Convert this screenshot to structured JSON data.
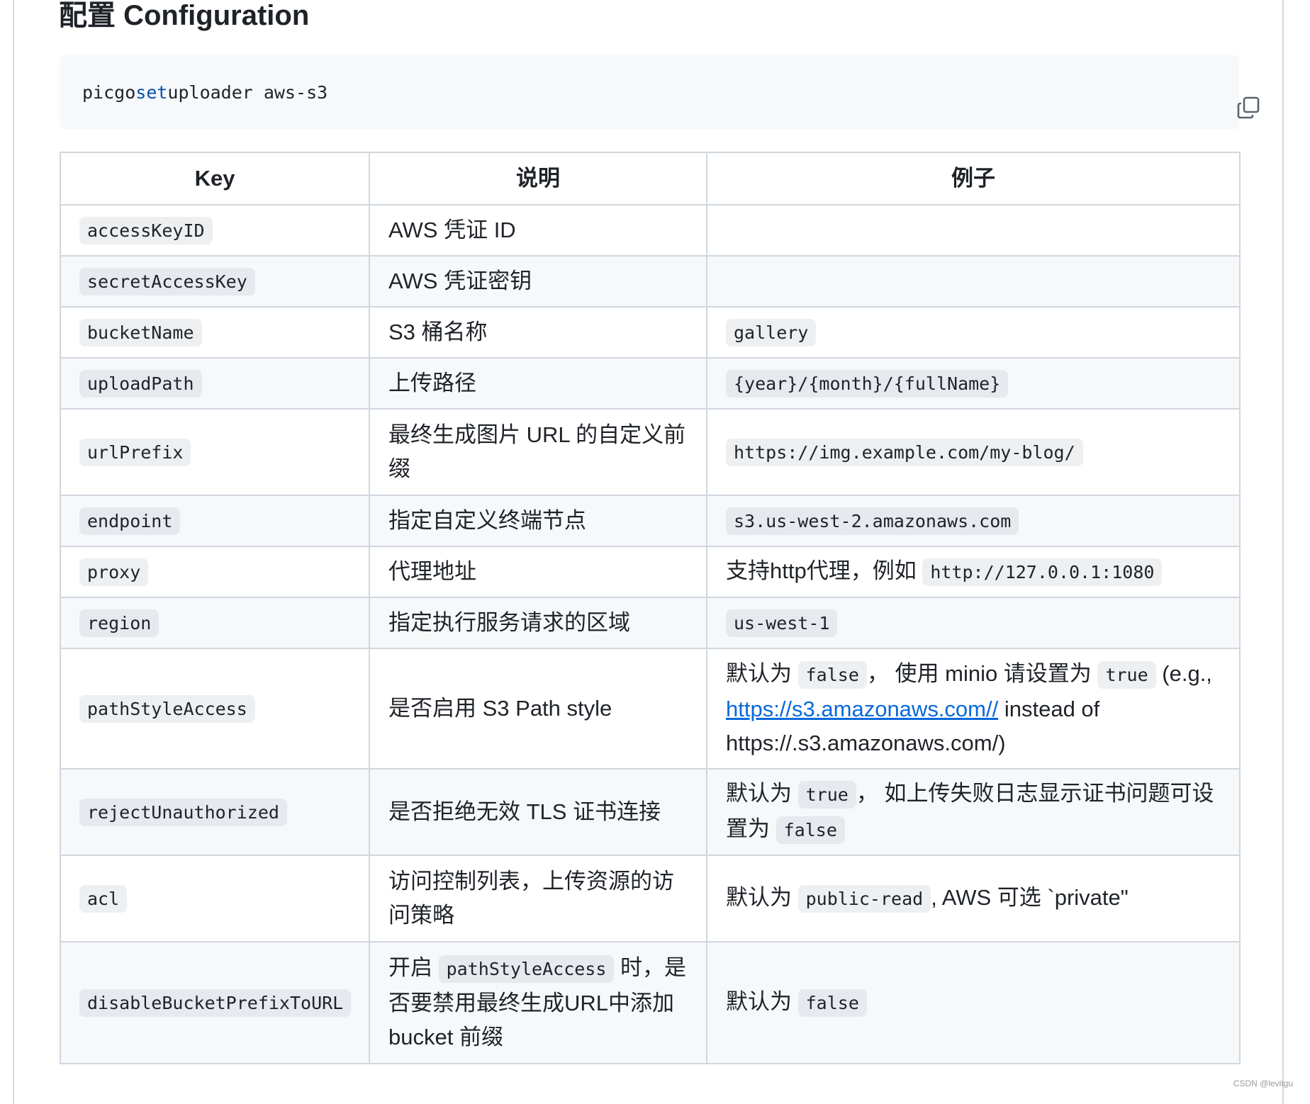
{
  "title": "配置 Configuration",
  "code": {
    "cmd": "picgo",
    "keyword": "set",
    "args": "uploader aws-s3",
    "copy_icon": "copy-icon"
  },
  "table": {
    "headers": [
      "Key",
      "说明",
      "例子"
    ],
    "rows": [
      {
        "key": "accessKeyID",
        "desc": "AWS 凭证 ID"
      },
      {
        "key": "secretAccessKey",
        "desc": "AWS 凭证密钥"
      },
      {
        "key": "bucketName",
        "desc": "S3 桶名称",
        "example_code": "gallery"
      },
      {
        "key": "uploadPath",
        "desc": "上传路径",
        "example_code": "{year}/{month}/{fullName}"
      },
      {
        "key": "urlPrefix",
        "desc": "最终生成图片 URL 的自定义前缀",
        "example_code": "https://img.example.com/my-blog/"
      },
      {
        "key": "endpoint",
        "desc": "指定自定义终端节点",
        "example_code": "s3.us-west-2.amazonaws.com"
      },
      {
        "key": "proxy",
        "desc": "代理地址",
        "example_text": "支持http代理，例如",
        "example_code": "http://127.0.0.1:1080"
      },
      {
        "key": "region",
        "desc": "指定执行服务请求的区域",
        "example_code": "us-west-1"
      },
      {
        "key": "pathStyleAccess",
        "desc": "是否启用 S3 Path style",
        "example": {
          "t1": "默认为",
          "c1": "false",
          "t2": "， 使用 minio 请设置为",
          "c2": "true",
          "t3": "(e.g.,",
          "link": "https://s3.amazonaws.com//",
          "t4": "instead of https://.s3.amazonaws.com/)"
        }
      },
      {
        "key": "rejectUnauthorized",
        "desc": "是否拒绝无效 TLS 证书连接",
        "example": {
          "t1": "默认为",
          "c1": "true",
          "t2": "， 如上传失败日志显示证书问题可设置为",
          "c2": "false"
        }
      },
      {
        "key": "acl",
        "desc": "访问控制列表，上传资源的访问策略",
        "example": {
          "t1": "默认为",
          "c1": "public-read",
          "t2": ", AWS 可选 `private\""
        }
      },
      {
        "key": "disableBucketPrefixToURL",
        "desc_parts": {
          "t1": "开启",
          "c1": "pathStyleAccess",
          "t2": "时，是否要禁用最终生成URL中添加 bucket 前缀"
        },
        "example": {
          "t1": "默认为",
          "c1": "false"
        }
      }
    ]
  },
  "watermark": "CSDN @levitgu"
}
